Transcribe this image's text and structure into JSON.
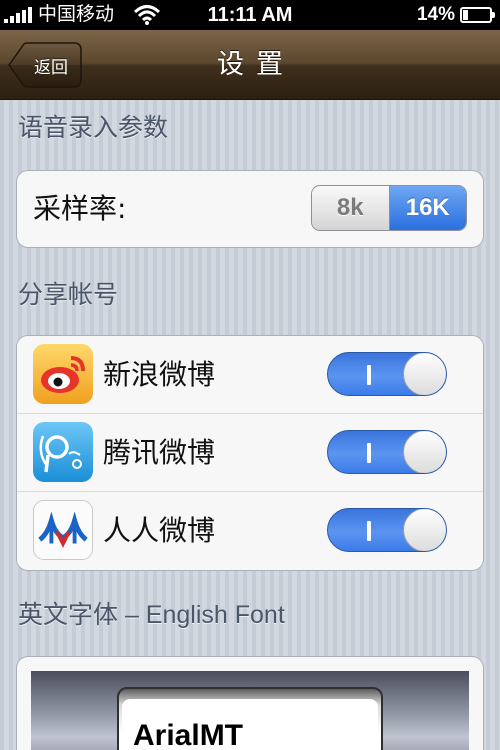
{
  "status_bar": {
    "carrier": "中国移动",
    "time": "11:11 AM",
    "battery": "14%"
  },
  "nav": {
    "back_label": "返回",
    "title": "设置"
  },
  "voice_section": {
    "header": "语音录入参数",
    "sample_rate_label": "采样率:",
    "options": [
      "8k",
      "16K"
    ],
    "selected": "16K"
  },
  "share_section": {
    "header": "分享帐号",
    "accounts": [
      {
        "label": "新浪微博",
        "icon": "sina-weibo-icon",
        "enabled": true
      },
      {
        "label": "腾讯微博",
        "icon": "tencent-weibo-icon",
        "enabled": true
      },
      {
        "label": "人人微博",
        "icon": "renren-icon",
        "enabled": true
      }
    ]
  },
  "font_section": {
    "header": "英文字体 – English Font",
    "selected_font": "ArialMT"
  },
  "colors": {
    "nav_brown": "#5c472f",
    "accent_blue": "#2b6fe0",
    "section_text": "#4c566a"
  }
}
